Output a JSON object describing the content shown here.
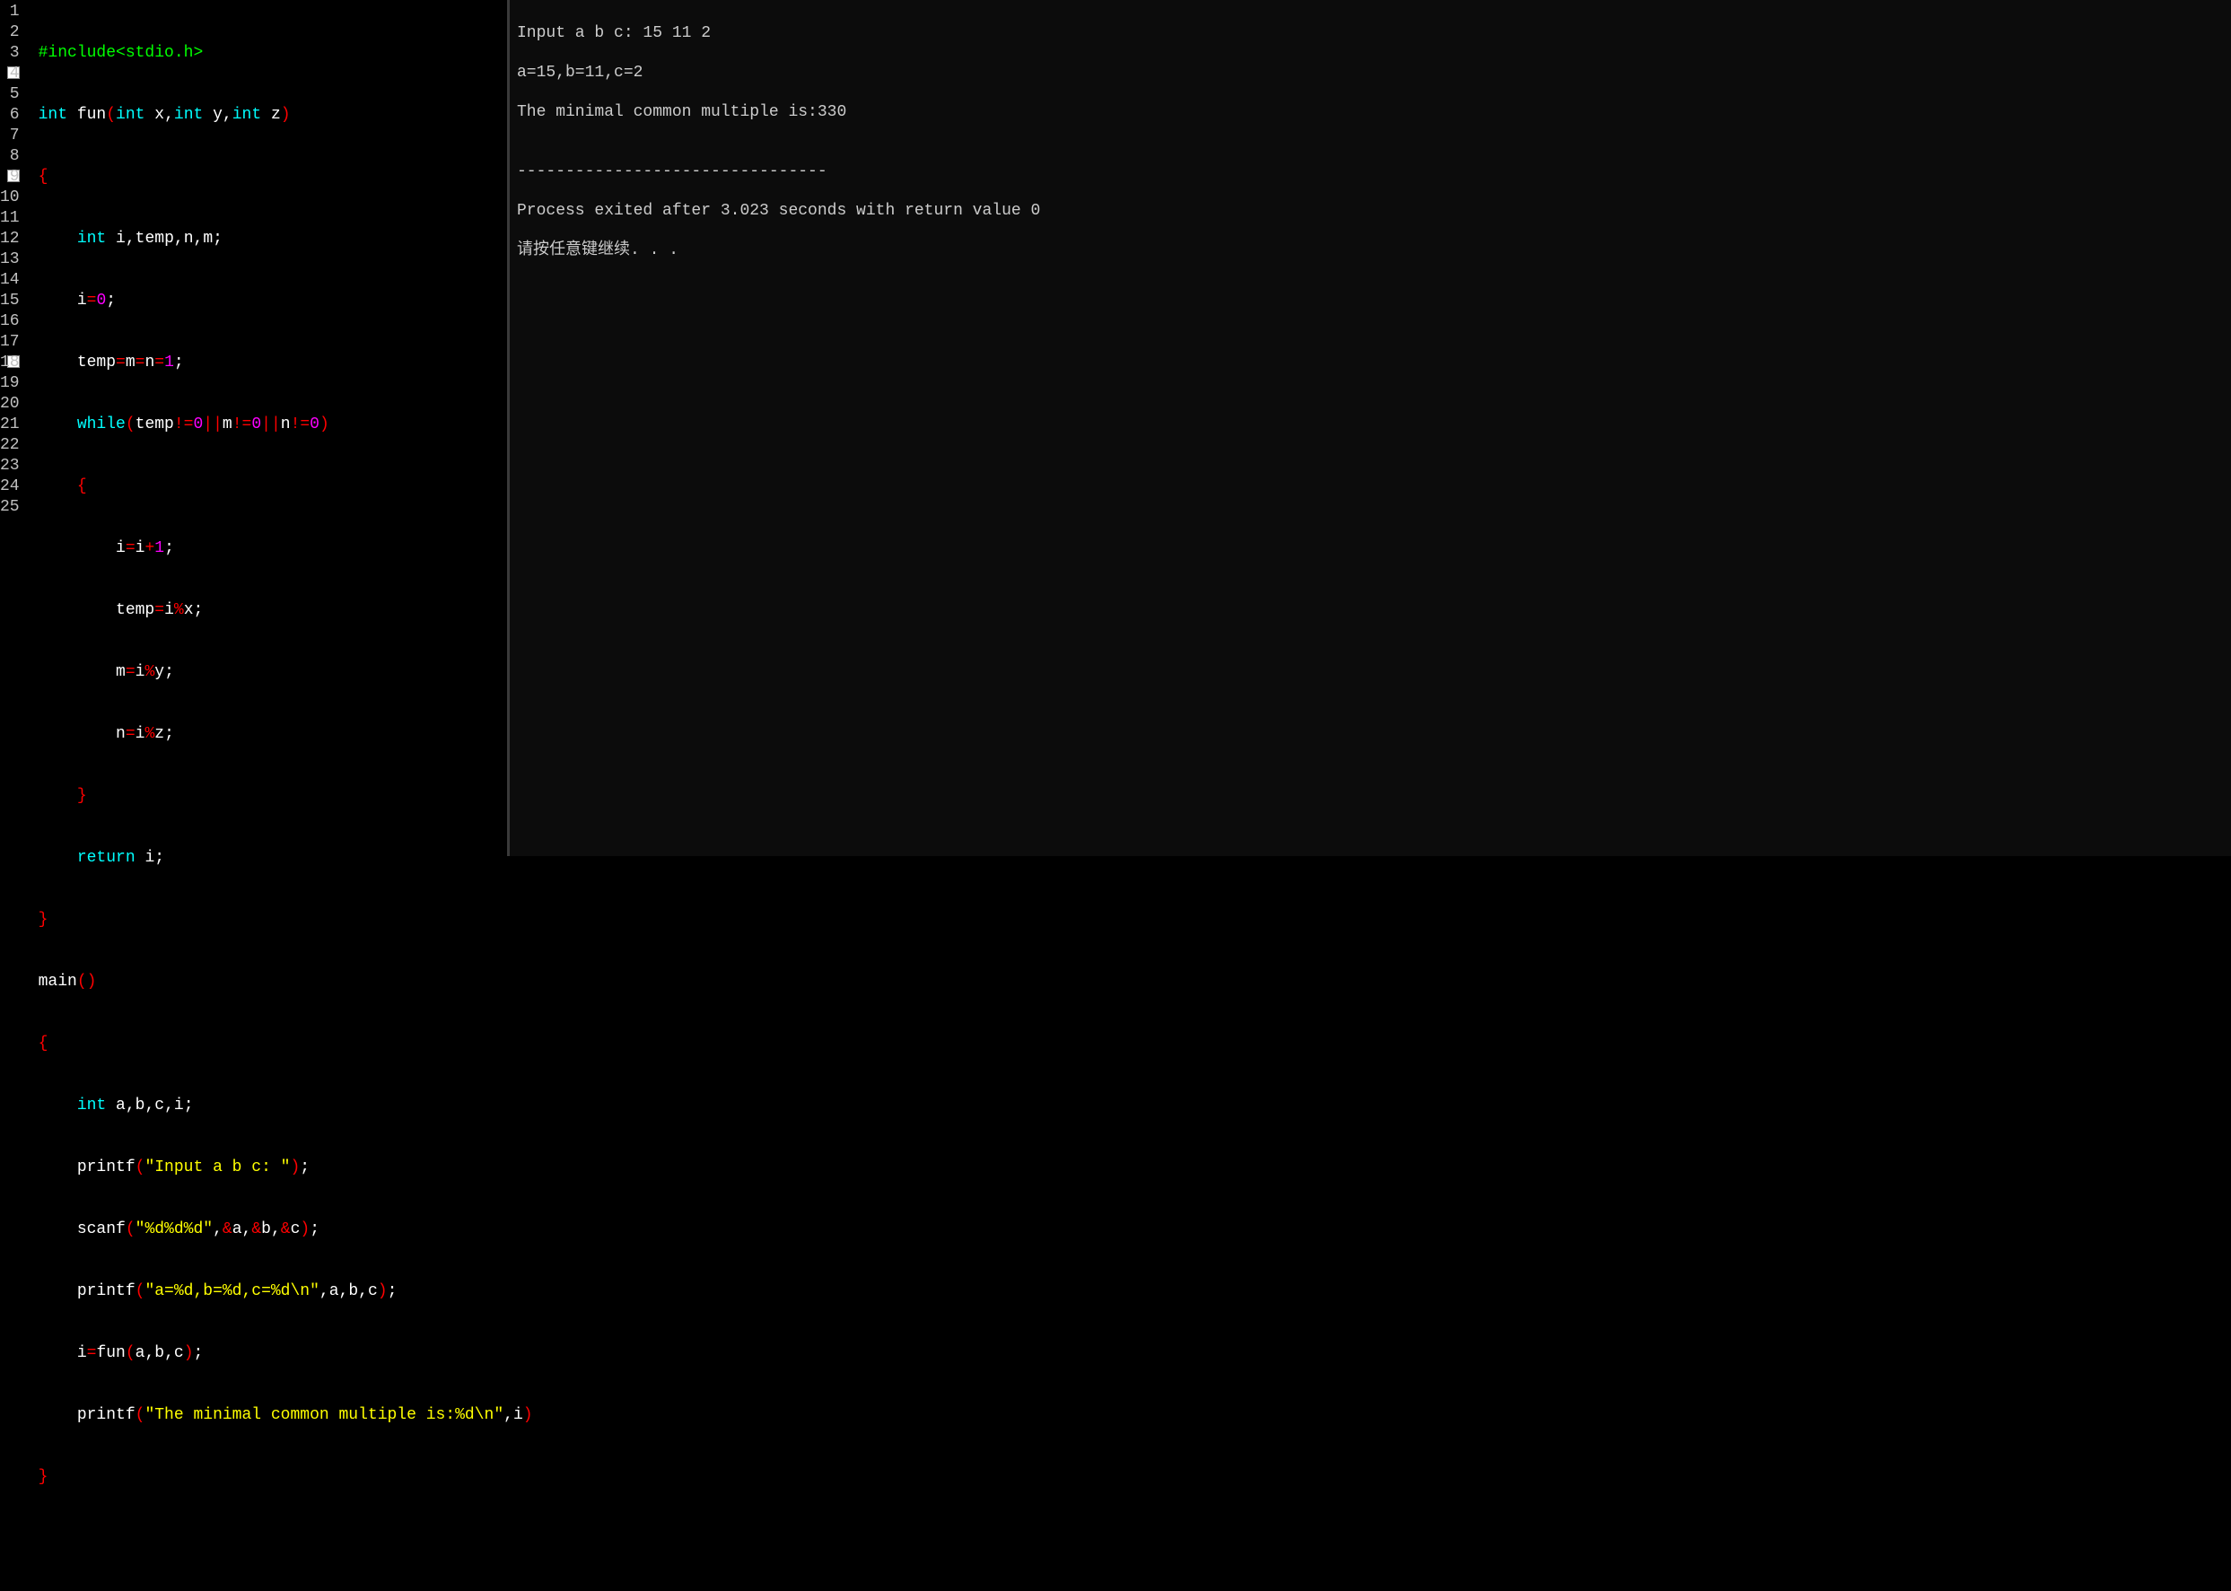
{
  "editor": {
    "lineNumbers": [
      "1",
      "2",
      "3",
      "4",
      "5",
      "6",
      "7",
      "8",
      "9",
      "10",
      "11",
      "12",
      "13",
      "14",
      "15",
      "16",
      "17",
      "18",
      "19",
      "20",
      "21",
      "22",
      "23",
      "24",
      "25"
    ],
    "breakpointLines": [
      3,
      8,
      17
    ],
    "code": {
      "l1": {
        "include": "#include",
        "header": "<stdio.h>"
      },
      "l2": {
        "kw1": "int ",
        "fn": "fun",
        "p1": "(",
        "t1": "int ",
        "a1": "x",
        "c1": ",",
        "t2": "int ",
        "a2": "y",
        "c2": ",",
        "t3": "int ",
        "a3": "z",
        "p2": ")"
      },
      "l3": {
        "brace": "{"
      },
      "l4": {
        "indent": "    ",
        "kw": "int ",
        "vars": "i",
        "c1": ",",
        "v2": "temp",
        "c2": ",",
        "v3": "n",
        "c3": ",",
        "v4": "m",
        "semi": ";"
      },
      "l5": {
        "indent": "    ",
        "v": "i",
        "op": "=",
        "n": "0",
        "semi": ";"
      },
      "l6": {
        "indent": "    ",
        "v1": "temp",
        "op1": "=",
        "v2": "m",
        "op2": "=",
        "v3": "n",
        "op3": "=",
        "n": "1",
        "semi": ";"
      },
      "l7": {
        "indent": "    ",
        "kw": "while",
        "p1": "(",
        "v1": "temp",
        "op1": "!=",
        "n1": "0",
        "op2": "||",
        "v2": "m",
        "op3": "!=",
        "n2": "0",
        "op4": "||",
        "v3": "n",
        "op5": "!=",
        "n3": "0",
        "p2": ")"
      },
      "l8": {
        "indent": "    ",
        "brace": "{"
      },
      "l9": {
        "indent": "        ",
        "v": "i",
        "op": "=",
        "v2": "i",
        "op2": "+",
        "n": "1",
        "semi": ";"
      },
      "l10": {
        "indent": "        ",
        "v": "temp",
        "op": "=",
        "v2": "i",
        "op2": "%",
        "v3": "x",
        "semi": ";"
      },
      "l11": {
        "indent": "        ",
        "v": "m",
        "op": "=",
        "v2": "i",
        "op2": "%",
        "v3": "y",
        "semi": ";"
      },
      "l12": {
        "indent": "        ",
        "v": "n",
        "op": "=",
        "v2": "i",
        "op2": "%",
        "v3": "z",
        "semi": ";"
      },
      "l13": {
        "indent": "    ",
        "brace": "}"
      },
      "l14": {
        "indent": "    ",
        "kw": "return ",
        "v": "i",
        "semi": ";"
      },
      "l15": {
        "brace": "}"
      },
      "l16": {
        "fn": "main",
        "p1": "(",
        "p2": ")"
      },
      "l17": {
        "brace": "{"
      },
      "l18": {
        "indent": "    ",
        "kw": "int ",
        "v1": "a",
        "c1": ",",
        "v2": "b",
        "c2": ",",
        "v3": "c",
        "c3": ",",
        "v4": "i",
        "semi": ";"
      },
      "l19": {
        "indent": "    ",
        "fn": "printf",
        "p1": "(",
        "str": "\"Input a b c: \"",
        "p2": ")",
        "semi": ";"
      },
      "l20": {
        "indent": "    ",
        "fn": "scanf",
        "p1": "(",
        "str": "\"%d%d%d\"",
        "c1": ",",
        "op1": "&",
        "v1": "a",
        "c2": ",",
        "op2": "&",
        "v2": "b",
        "c3": ",",
        "op3": "&",
        "v3": "c",
        "p2": ")",
        "semi": ";"
      },
      "l21": {
        "indent": "    ",
        "fn": "printf",
        "p1": "(",
        "str": "\"a=%d,b=%d,c=%d\\n\"",
        "c1": ",",
        "v1": "a",
        "c2": ",",
        "v2": "b",
        "c3": ",",
        "v3": "c",
        "p2": ")",
        "semi": ";"
      },
      "l22": {
        "indent": "    ",
        "v": "i",
        "op": "=",
        "fn": "fun",
        "p1": "(",
        "v1": "a",
        "c1": ",",
        "v2": "b",
        "c2": ",",
        "v3": "c",
        "p2": ")",
        "semi": ";"
      },
      "l23": {
        "indent": "    ",
        "fn": "printf",
        "p1": "(",
        "str": "\"The minimal common multiple is:%d\\n\"",
        "c1": ",",
        "v1": "i",
        "p2": ")"
      },
      "l24": {
        "brace": "}"
      }
    }
  },
  "console": {
    "line1": "Input a b c: 15 11 2",
    "line2": "a=15,b=11,c=2",
    "line3": "The minimal common multiple is:330",
    "line4": "",
    "line5": "--------------------------------",
    "line6": "Process exited after 3.023 seconds with return value 0",
    "line7": "请按任意键继续. . ."
  }
}
